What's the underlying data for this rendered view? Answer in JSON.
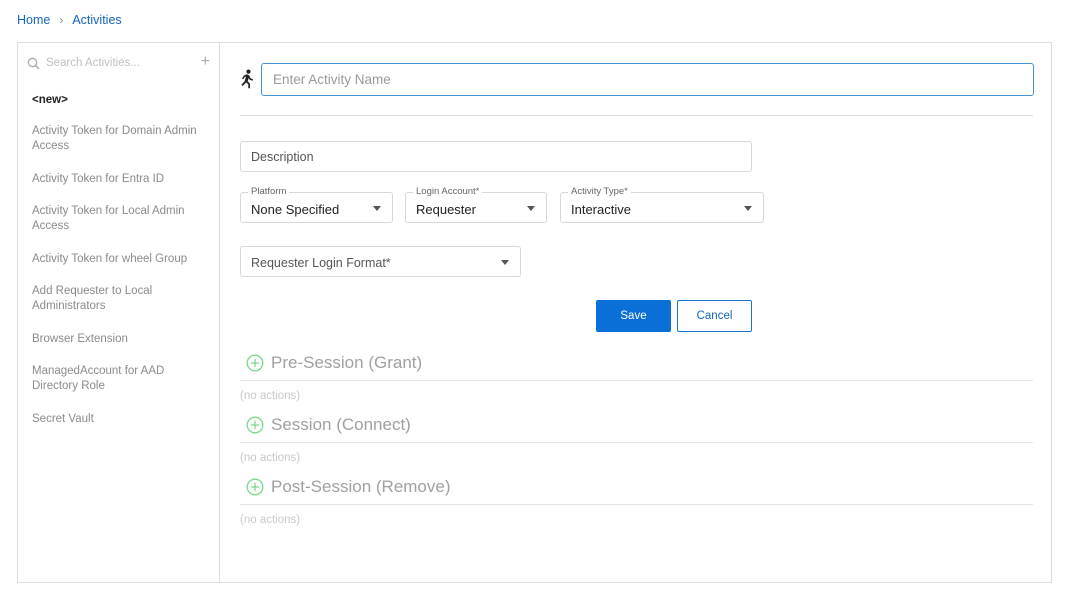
{
  "breadcrumb": {
    "home": "Home",
    "separator": "›",
    "current": "Activities"
  },
  "sidebar": {
    "search_placeholder": "Search Activities...",
    "add_label": "+",
    "items": [
      {
        "label": "<new>"
      },
      {
        "label": "Activity Token for Domain Admin Access"
      },
      {
        "label": "Activity Token for Entra ID"
      },
      {
        "label": "Activity Token for Local Admin Access"
      },
      {
        "label": "Activity Token for wheel Group"
      },
      {
        "label": "Add Requester to Local Administrators"
      },
      {
        "label": "Browser Extension"
      },
      {
        "label": "ManagedAccount for AAD Directory Role"
      },
      {
        "label": "Secret Vault"
      }
    ]
  },
  "form": {
    "name_placeholder": "Enter Activity Name",
    "description_placeholder": "Description",
    "platform": {
      "label": "Platform",
      "value": "None Specified"
    },
    "login_account": {
      "label": "Login Account*",
      "value": "Requester"
    },
    "activity_type": {
      "label": "Activity Type*",
      "value": "Interactive"
    },
    "requester_login_format": {
      "placeholder": "Requester Login Format*"
    },
    "save_label": "Save",
    "cancel_label": "Cancel"
  },
  "sections": [
    {
      "title": "Pre-Session (Grant)",
      "empty": "(no actions)"
    },
    {
      "title": "Session (Connect)",
      "empty": "(no actions)"
    },
    {
      "title": "Post-Session (Remove)",
      "empty": "(no actions)"
    }
  ],
  "colors": {
    "accent": "#0b6fd8",
    "link": "#1565c0",
    "add_icon": "#7cd98a",
    "border": "#dcdcdc"
  }
}
